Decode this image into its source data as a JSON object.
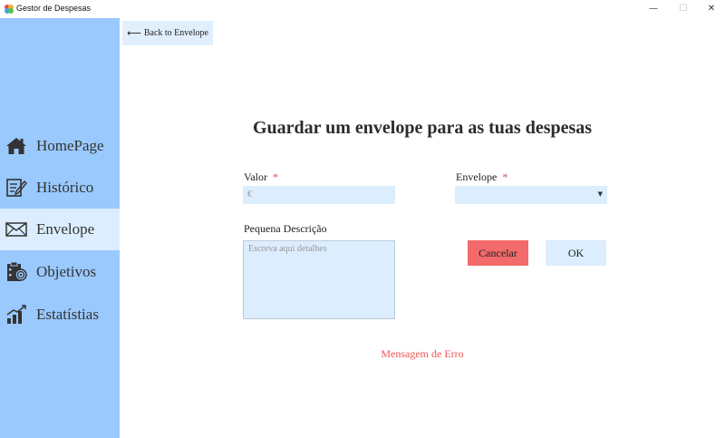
{
  "window": {
    "title": "Gestor de Despesas",
    "minimize": "—",
    "maximize": "☐",
    "close": "✕"
  },
  "sidebar": {
    "items": [
      {
        "label": "HomePage",
        "icon": "home-icon",
        "active": false
      },
      {
        "label": "Histórico",
        "icon": "history-icon",
        "active": false
      },
      {
        "label": "Envelope",
        "icon": "envelope-icon",
        "active": true
      },
      {
        "label": "Objetivos",
        "icon": "objectives-icon",
        "active": false
      },
      {
        "label": "Estatístias",
        "icon": "statistics-icon",
        "active": false
      }
    ]
  },
  "back_button": {
    "arrow": "⟵",
    "label": "Back to Envelope"
  },
  "page_title": "Guardar um envelope para as tuas despesas",
  "form": {
    "valor": {
      "label": "Valor",
      "required": "*",
      "placeholder": "€"
    },
    "envelope": {
      "label": "Envelope",
      "required": "*",
      "value": ""
    },
    "descricao": {
      "label": "Pequena Descrição",
      "placeholder": "Escreva aqui detalhes"
    }
  },
  "buttons": {
    "cancel": "Cancelar",
    "ok": "OK"
  },
  "error_message": "Mensagem de Erro",
  "colors": {
    "sidebar_bg": "#99c9fd",
    "active_item_bg": "#dbedfe",
    "input_bg": "#dcedfe",
    "cancel_bg": "#f26a6a",
    "error_text": "#f05555"
  }
}
